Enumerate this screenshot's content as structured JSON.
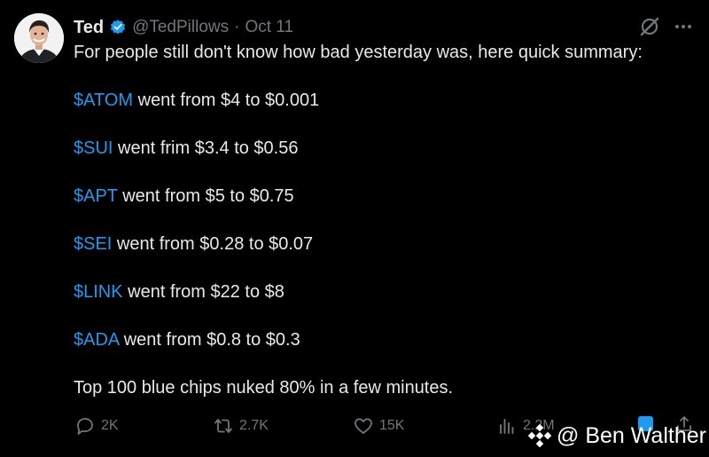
{
  "author": {
    "name": "Ted",
    "handle": "@TedPillows",
    "separator": "·",
    "date": "Oct 11"
  },
  "tweet": {
    "intro": "For people still don't know how bad yesterday was, here quick summary:",
    "items": [
      {
        "tag": "$ATOM",
        "text": " went from $4 to $0.001"
      },
      {
        "tag": "$SUI",
        "text": " went frim $3.4 to $0.56"
      },
      {
        "tag": "$APT",
        "text": " went from $5 to $0.75"
      },
      {
        "tag": "$SEI",
        "text": " went from $0.28 to $0.07"
      },
      {
        "tag": "$LINK",
        "text": " went from $22 to $8"
      },
      {
        "tag": "$ADA",
        "text": " went from $0.8 to $0.3"
      }
    ],
    "closing": "Top 100 blue chips nuked 80% in a few minutes."
  },
  "actions": {
    "replies": "2K",
    "reposts": "2.7K",
    "likes": "15K",
    "views": "2.2M"
  },
  "watermark": {
    "text": "@ Ben Walther"
  },
  "colors": {
    "background": "#000000",
    "text": "#e7e9ea",
    "muted": "#71767b",
    "cashtag": "#1d9bf0",
    "verified": "#1d9bf0",
    "binance": "#f0b90b"
  }
}
